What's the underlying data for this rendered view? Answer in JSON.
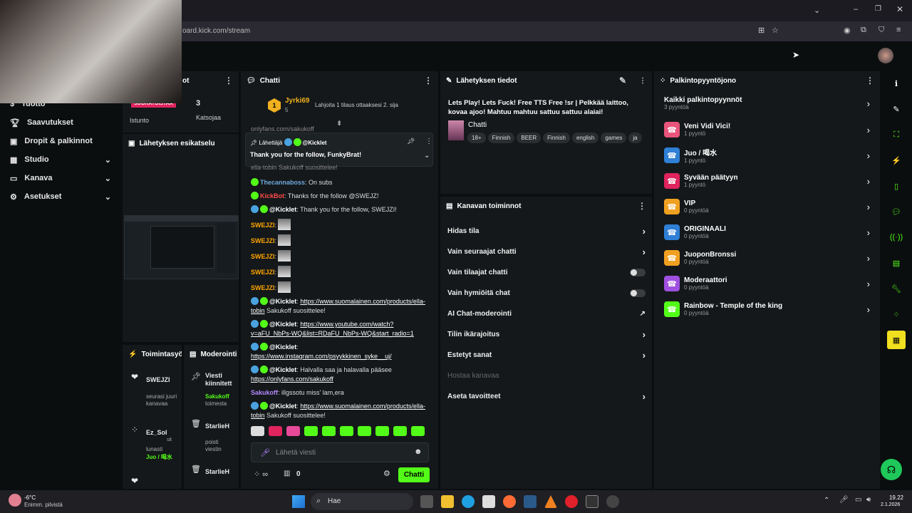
{
  "browser": {
    "url": "oard.kick.com/stream"
  },
  "sidebar": {
    "items": [
      {
        "label": "Tuotto",
        "icon": "dollar-icon",
        "expand": false
      },
      {
        "label": "Saavutukset",
        "icon": "trophy-icon",
        "expand": false
      },
      {
        "label": "Dropit & palkinnot",
        "icon": "gift-icon",
        "expand": false
      },
      {
        "label": "Studio",
        "icon": "studio-icon",
        "expand": true
      },
      {
        "label": "Kanava",
        "icon": "channel-icon",
        "expand": true
      },
      {
        "label": "Asetukset",
        "icon": "gear-icon",
        "expand": true
      }
    ]
  },
  "stats": {
    "title_suffix": "ot",
    "live_badge": "SUORATOISTAA",
    "session_label": "Istunto",
    "viewers_value": "3",
    "viewers_label": "Katsojaa"
  },
  "preview": {
    "title": "Lähetyksen esikatselu"
  },
  "activity": {
    "title": "Toimintasyöt",
    "items": [
      {
        "name": "SWEJZI",
        "desc": "seurasi juuri kanavaa"
      },
      {
        "name": "Ez_Sol",
        "extra": "sit",
        "desc": "lunasti",
        "reward": "Juo / 喝水"
      }
    ]
  },
  "moderation": {
    "title": "Moderointi",
    "items": [
      {
        "title": "Viesti kiinnitett",
        "name": "Sakukoff",
        "desc": "toimesta"
      },
      {
        "title": "StarlieH",
        "desc": "poisti viestin"
      },
      {
        "title": "StarlieH",
        "desc": ""
      }
    ]
  },
  "chat": {
    "title": "Chatti",
    "top_user": "Jyrki69",
    "top_rank": "1",
    "top_count": "5",
    "gift_text": "Lahjoita 1 tilaus ottaaksesi 2. sija",
    "partial_top": "onlyfans.com/sakukoff",
    "pinned_label": "Lähettäjä",
    "pinned_by": "@Kicklet",
    "pinned_text": "Thank you for the follow, FunkyBrat!",
    "partial_line": "ella-tobin Sakukoff suosittelee!",
    "messages": [
      {
        "user": "Thecannaboss",
        "cls": "name-blue",
        "text": ": On subs"
      },
      {
        "user": "KickBot",
        "cls": "name-red",
        "text": ": Thanks for the follow @SWEJZ!"
      },
      {
        "user": "@Kicklet",
        "cls": "name-white",
        "text": ": Thank you for the follow, SWEJZI!"
      },
      {
        "user": "SWEJZI",
        "cls": "name-orange",
        "text": ":"
      },
      {
        "user": "SWEJZI",
        "cls": "name-orange",
        "text": ":"
      },
      {
        "user": "SWEJZI",
        "cls": "name-orange",
        "text": ":"
      },
      {
        "user": "SWEJZI",
        "cls": "name-orange",
        "text": ":"
      },
      {
        "user": "SWEJZI",
        "cls": "name-orange",
        "text": ":"
      },
      {
        "user": "@Kicklet",
        "cls": "name-white",
        "text": ": ",
        "link": "https://www.suomalainen.com/products/ella-tobin",
        "after": " Sakukoff suosittelee!"
      },
      {
        "user": "@Kicklet",
        "cls": "name-white",
        "text": ": ",
        "link": "https://www.youtube.com/watch?v=aFU_NbPs-WQ&list=RDaFU_NbPs-WQ&start_radio=1",
        "after": ""
      },
      {
        "user": "@Kicklet",
        "cls": "name-white",
        "text": ": ",
        "link": "https://www.instagram.com/psyykkinen_syke__uj/",
        "after": ""
      },
      {
        "user": "@Kicklet",
        "cls": "name-white",
        "text": ": Halvalla saa ja halavalla pääsee ",
        "link": "https://onlyfans.com/sakukoff",
        "after": ""
      },
      {
        "user": "Sakukoff",
        "cls": "name-purple",
        "text": ": illgssotu miss' lam,era"
      },
      {
        "user": "@Kicklet",
        "cls": "name-white",
        "text": ": ",
        "link": "https://www.suomalainen.com/products/ella-tobin",
        "after": " Sakukoff suosittelee!"
      }
    ],
    "input_placeholder": "Lähetä viesti",
    "points_value": "0",
    "send_label": "Chatti"
  },
  "stream_info": {
    "title": "Lähetyksen tiedot",
    "stream_title": "Lets Play! Lets Fuck! Free TTS Free !sr | Pelkkää laittoo, kovaa ajoo! Mahtuu mahtuu sattuu sattuu alaiai!",
    "category": "Chatti",
    "tags": [
      "18+",
      "Finnish",
      "BEER",
      "Finnish",
      "english",
      "games",
      "ja"
    ]
  },
  "channel_actions": {
    "title": "Kanavan toiminnot",
    "items": [
      {
        "label": "Hidas tila",
        "type": "chev"
      },
      {
        "label": "Vain seuraajat chatti",
        "type": "chev"
      },
      {
        "label": "Vain tilaajat chatti",
        "type": "toggle"
      },
      {
        "label": "Vain hymiöitä chat",
        "type": "toggle"
      },
      {
        "label": "AI Chat-moderointi",
        "type": "ext"
      },
      {
        "label": "Tilin ikärajoitus",
        "type": "chev"
      },
      {
        "label": "Estetyt sanat",
        "type": "chev"
      },
      {
        "label": "Hostaa kanavaa",
        "type": "disabled"
      },
      {
        "label": "Aseta tavoitteet",
        "type": "chev"
      }
    ]
  },
  "rewards": {
    "title": "Palkintopyyntöjono",
    "all_label": "Kaikki palkintopyynnöt",
    "all_count": "3 pyyntöä",
    "items": [
      {
        "name": "Veni Vidi Vici!",
        "count": "1 pyyntö",
        "color": "#e8547a"
      },
      {
        "name": "Juo / 喝水",
        "count": "1 pyyntö",
        "color": "#2f7fd6"
      },
      {
        "name": "Syvään päätyyn",
        "count": "1 pyyntö",
        "color": "#e0245e"
      },
      {
        "name": "VIP",
        "count": "0 pyyntöä",
        "color": "#f0a020"
      },
      {
        "name": "ORIGINAALI",
        "count": "0 pyyntöä",
        "color": "#2f7fd6"
      },
      {
        "name": "JuoponBronssi",
        "count": "0 pyyntöä",
        "color": "#f0a020"
      },
      {
        "name": "Moderaattori",
        "count": "0 pyyntöä",
        "color": "#a050e0"
      },
      {
        "name": "Rainbow - Temple of the king",
        "count": "0 pyyntöä",
        "color": "#53fc18"
      }
    ]
  },
  "taskbar": {
    "weather_temp": "-6°C",
    "weather_desc": "Enimm. pilvistä",
    "search_label": "Hae",
    "time": "19.22",
    "date": "2.1.2026"
  },
  "colors": {
    "accent": "#53fc18",
    "panel": "#14181a",
    "background": "#0b0e0f"
  }
}
